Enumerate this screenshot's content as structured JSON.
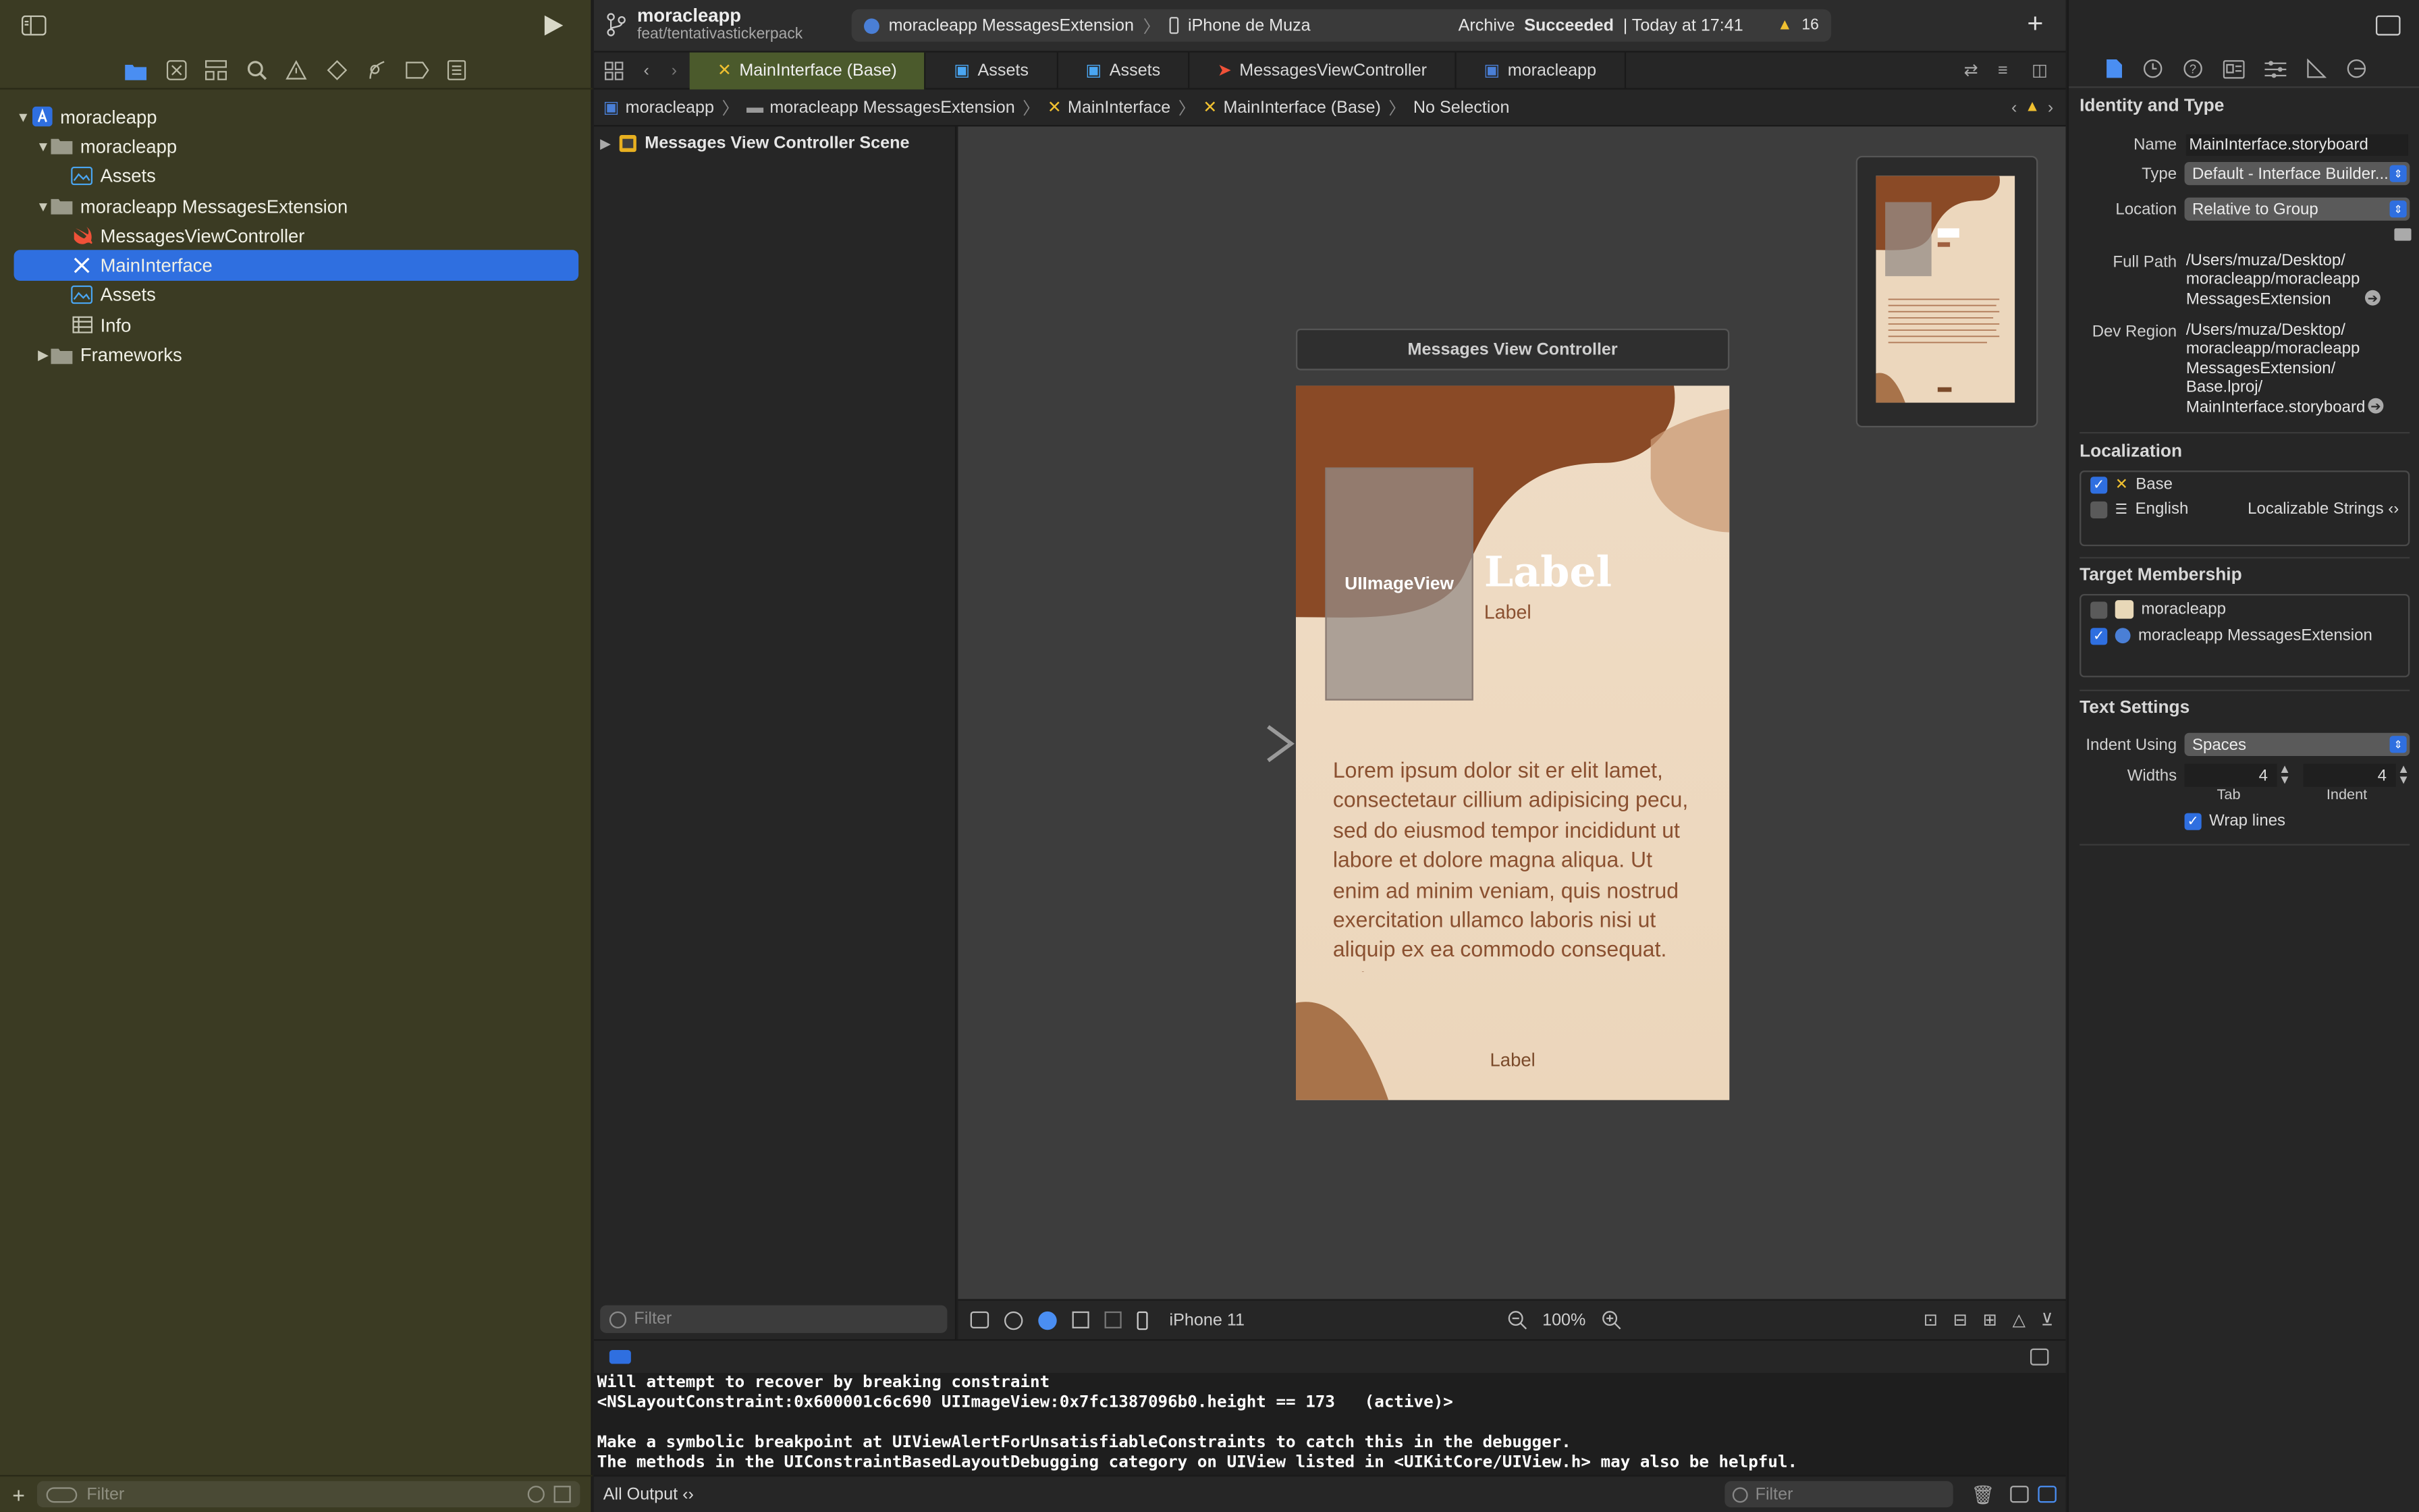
{
  "project": {
    "name": "moracleapp",
    "branch": "feat/tentativastickerpack"
  },
  "scheme": {
    "target": "moracleapp MessagesExtension",
    "device": "iPhone de Muza",
    "status_prefix": "Archive",
    "status_strong": "Succeeded",
    "status_time": "| Today at 17:41",
    "warnings": "16"
  },
  "tabs": [
    {
      "label": "MainInterface (Base)"
    },
    {
      "label": "Assets"
    },
    {
      "label": "Assets"
    },
    {
      "label": "MessagesViewController"
    },
    {
      "label": "moracleapp"
    }
  ],
  "jumpbar": [
    "moracleapp",
    "moracleapp MessagesExtension",
    "MainInterface",
    "MainInterface (Base)",
    "No Selection"
  ],
  "navigator": {
    "tree": [
      {
        "label": "moracleapp"
      },
      {
        "label": "moracleapp"
      },
      {
        "label": "Assets"
      },
      {
        "label": "moracleapp MessagesExtension"
      },
      {
        "label": "MessagesViewController"
      },
      {
        "label": "MainInterface"
      },
      {
        "label": "Assets"
      },
      {
        "label": "Info"
      },
      {
        "label": "Frameworks"
      }
    ],
    "filter_placeholder": "Filter"
  },
  "outline": {
    "scene": "Messages View Controller Scene",
    "filter_placeholder": "Filter"
  },
  "canvas": {
    "scene_title": "Messages View Controller",
    "image_view": "UIImageView",
    "label_big": "Label",
    "label_small": "Label",
    "body_text": "Lorem ipsum dolor sit er elit lamet, consectetaur cillium adipisicing pecu, sed do eiusmod tempor incididunt ut labore et dolore magna aliqua. Ut enim ad minim veniam, quis nostrud exercitation ullamco laboris nisi ut aliquip ex ea commodo consequat. Duis aute",
    "label_bottom": "Label",
    "device": "iPhone 11",
    "zoom": "100%"
  },
  "console": {
    "lines": [
      "Will attempt to recover by breaking constraint",
      "<NSLayoutConstraint:0x600001c6c690 UIImageView:0x7fc1387096b0.height == 173   (active)>",
      "",
      "Make a symbolic breakpoint at UIViewAlertForUnsatisfiableConstraints to catch this in the debugger.",
      "The methods in the UIConstraintBasedLayoutDebugging category on UIView listed in <UIKitCore/UIView.h> may also be helpful."
    ],
    "output_selector": "All Output ‹›",
    "filter_placeholder": "Filter"
  },
  "inspector": {
    "identity": {
      "title": "Identity and Type",
      "name_label": "Name",
      "name_value": "MainInterface.storyboard",
      "type_label": "Type",
      "type_value": "Default - Interface Builder...",
      "location_label": "Location",
      "location_value": "Relative to Group",
      "fullpath_label": "Full Path",
      "fullpath_lines": [
        "/Users/muza/Desktop/",
        "moracleapp/moracleapp",
        "MessagesExtension"
      ],
      "devregion_label": "Dev Region",
      "devregion_lines": [
        "/Users/muza/Desktop/",
        "moracleapp/moracleapp",
        "MessagesExtension/",
        "Base.lproj/",
        "MainInterface.storyboard"
      ]
    },
    "localization": {
      "title": "Localization",
      "items": [
        {
          "label": "Base",
          "checked": true
        },
        {
          "label": "English",
          "checked": false,
          "value": "Localizable Strings ‹›"
        }
      ]
    },
    "target_membership": {
      "title": "Target Membership",
      "items": [
        {
          "label": "moracleapp",
          "checked": false
        },
        {
          "label": "moracleapp MessagesExtension",
          "checked": true
        }
      ]
    },
    "text_settings": {
      "title": "Text Settings",
      "indent_label": "Indent Using",
      "indent_value": "Spaces",
      "widths_label": "Widths",
      "tab_value": "4",
      "indent_width_value": "4",
      "tab_caption": "Tab",
      "indent_caption": "Indent",
      "wrap_label": "Wrap lines"
    }
  },
  "colors": {
    "accent": "#2f6fe0",
    "navigator_bg": "#3b3b23",
    "scene_bg": "#edd9c0",
    "blob_dark": "#8a4a26",
    "text_brown": "#8a5030"
  }
}
